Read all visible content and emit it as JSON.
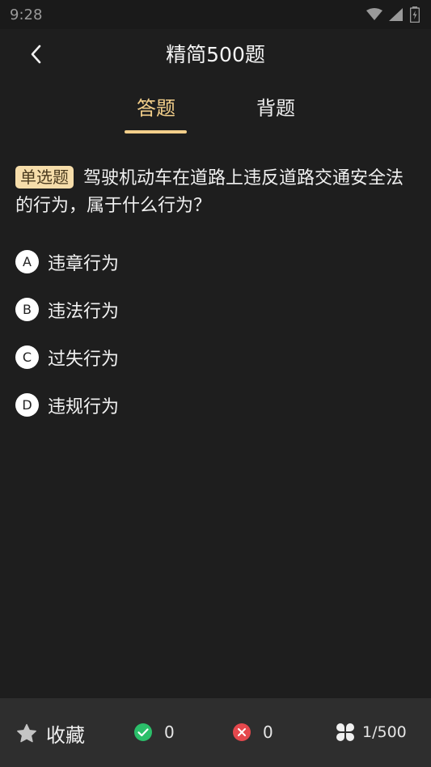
{
  "status_bar": {
    "time": "9:28"
  },
  "header": {
    "title": "精简500题"
  },
  "tabs": [
    {
      "label": "答题",
      "active": true
    },
    {
      "label": "背题",
      "active": false
    }
  ],
  "question": {
    "type_badge": "单选题",
    "text": "驾驶机动车在道路上违反道路交通安全法的行为，属于什么行为？"
  },
  "options": [
    {
      "letter": "A",
      "text": "违章行为"
    },
    {
      "letter": "B",
      "text": "违法行为"
    },
    {
      "letter": "C",
      "text": "过失行为"
    },
    {
      "letter": "D",
      "text": "违规行为"
    }
  ],
  "bottom_bar": {
    "favorite_label": "收藏",
    "correct_count": "0",
    "wrong_count": "0",
    "progress": "1/500"
  },
  "colors": {
    "accent": "#f3cf8a",
    "correct": "#2bbf6a",
    "wrong": "#e5484d"
  },
  "icons": [
    "back-arrow-icon",
    "wifi-icon",
    "signal-icon",
    "battery-icon",
    "star-icon",
    "check-circle-icon",
    "x-circle-icon",
    "grid-icon"
  ]
}
